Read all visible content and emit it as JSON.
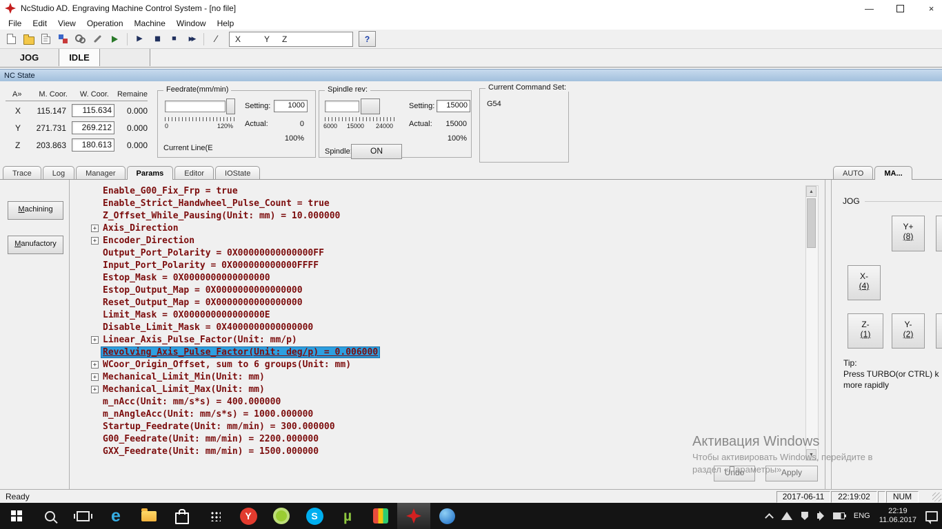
{
  "window": {
    "title": "NcStudio AD. Engraving Machine Control System - [no file]"
  },
  "menubar": {
    "items": [
      "File",
      "Edit",
      "View",
      "Operation",
      "Machine",
      "Window",
      "Help"
    ]
  },
  "toolbar": {
    "coord_labels": [
      "X",
      "Y",
      "Z"
    ]
  },
  "mode_tabs": {
    "mode": "JOG",
    "state": "IDLE"
  },
  "nc_state": {
    "label": "NC State"
  },
  "coords": {
    "headers": {
      "axis": "A»",
      "machine": "M. Coor.",
      "work": "W. Coor.",
      "remain": "Remaine"
    },
    "rows": [
      {
        "axis": "X",
        "machine": "115.147",
        "work": "115.634",
        "remain": "0.000"
      },
      {
        "axis": "Y",
        "machine": "271.731",
        "work": "269.212",
        "remain": "0.000"
      },
      {
        "axis": "Z",
        "machine": "203.863",
        "work": "180.613",
        "remain": "0.000"
      }
    ]
  },
  "feedrate": {
    "title": "Feedrate(mm/min)",
    "scale_min": "0",
    "scale_max": "120%",
    "setting_label": "Setting:",
    "setting_value": "1000",
    "actual_label": "Actual:",
    "actual_value": "0",
    "percent": "100%",
    "current_line": "Current Line(E"
  },
  "spindle": {
    "title": "Spindle rev:",
    "scale_low": "6000",
    "scale_mid": "15000",
    "scale_high": "24000",
    "setting_label": "Setting:",
    "setting_value": "15000",
    "actual_label": "Actual:",
    "actual_value": "15000",
    "percent": "100%",
    "spindle_label": "Spindle:",
    "on_label": "ON"
  },
  "command_set": {
    "title": "Current Command Set:",
    "value": "G54"
  },
  "main_tabs": {
    "items": [
      "Trace",
      "Log",
      "Manager",
      "Params",
      "Editor",
      "IOState"
    ],
    "active": "Params"
  },
  "side_panel": {
    "machining": "Machining",
    "manufactory": "Manufactory"
  },
  "params": {
    "items": [
      {
        "text": "Enable_G00_Fix_Frp = true"
      },
      {
        "text": "Enable_Strict_Handwheel_Pulse_Count = true"
      },
      {
        "text": "Z_Offset_While_Pausing(Unit: mm) = 10.000000"
      },
      {
        "text": "Axis_Direction",
        "expandable": true
      },
      {
        "text": "Encoder_Direction",
        "expandable": true
      },
      {
        "text": "Output_Port_Polarity = 0X00000000000000FF"
      },
      {
        "text": "Input_Port_Polarity = 0X000000000000FFFF"
      },
      {
        "text": "Estop_Mask = 0X0000000000000000"
      },
      {
        "text": "Estop_Output_Map = 0X0000000000000000"
      },
      {
        "text": "Reset_Output_Map = 0X0000000000000000"
      },
      {
        "text": "Limit_Mask = 0X000000000000000E"
      },
      {
        "text": "Disable_Limit_Mask = 0X4000000000000000"
      },
      {
        "text": "Linear_Axis_Pulse_Factor(Unit: mm/p)",
        "expandable": true
      },
      {
        "text": "Revolving_Axis_Pulse_Factor(Unit: deg/p) = 0.006000",
        "selected": true
      },
      {
        "text": "WCoor_Origin_Offset, sum to 6 groups(Unit: mm)",
        "expandable": true
      },
      {
        "text": "Mechanical_Limit_Min(Unit: mm)",
        "expandable": true
      },
      {
        "text": "Mechanical_Limit_Max(Unit: mm)",
        "expandable": true
      },
      {
        "text": "m_nAcc(Unit: mm/s*s) = 400.000000"
      },
      {
        "text": "m_nAngleAcc(Unit: mm/s*s) = 1000.000000"
      },
      {
        "text": "Startup_Feedrate(Unit: mm/min) = 300.000000"
      },
      {
        "text": "G00_Feedrate(Unit: mm/min) = 2200.000000"
      },
      {
        "text": "GXX_Feedrate(Unit: mm/min) = 1500.000000"
      }
    ]
  },
  "right_panel": {
    "tab_auto": "AUTO",
    "tab_ma": "MA...",
    "group": "JOG",
    "jog": [
      {
        "axis": "Y+",
        "key": "(8)"
      },
      {
        "axis": "X-",
        "key": "(4)"
      },
      {
        "axis": "Z-",
        "key": "(1)"
      },
      {
        "axis": "Y-",
        "key": "(2)"
      }
    ],
    "tip_title": "Tip:",
    "tip_line1": "Press TURBO(or CTRL) k",
    "tip_line2": "more rapidly"
  },
  "actions": {
    "undo": "Undo",
    "apply": "Apply"
  },
  "watermark": {
    "title": "Активация Windows",
    "line1": "Чтобы активировать Windows, перейдите в",
    "line2": "раздел «Параметры»."
  },
  "statusbar": {
    "ready": "Ready",
    "date": "2017-06-11",
    "time": "22:19:02",
    "num": "NUM"
  },
  "taskbar": {
    "lang": "ENG",
    "time": "22:19",
    "date": "11.06.2017"
  },
  "icons": {
    "expand": "+",
    "play": "▶",
    "pause": "▮▮",
    "stop": "■",
    "step": "▶▶",
    "slash": "∕",
    "help": "?",
    "minimize": "—",
    "close": "×",
    "scroll_up": "▲",
    "scroll_down": "▼",
    "edge": "e",
    "yandex": "Y",
    "skype": "S",
    "utorrent": "µ"
  }
}
